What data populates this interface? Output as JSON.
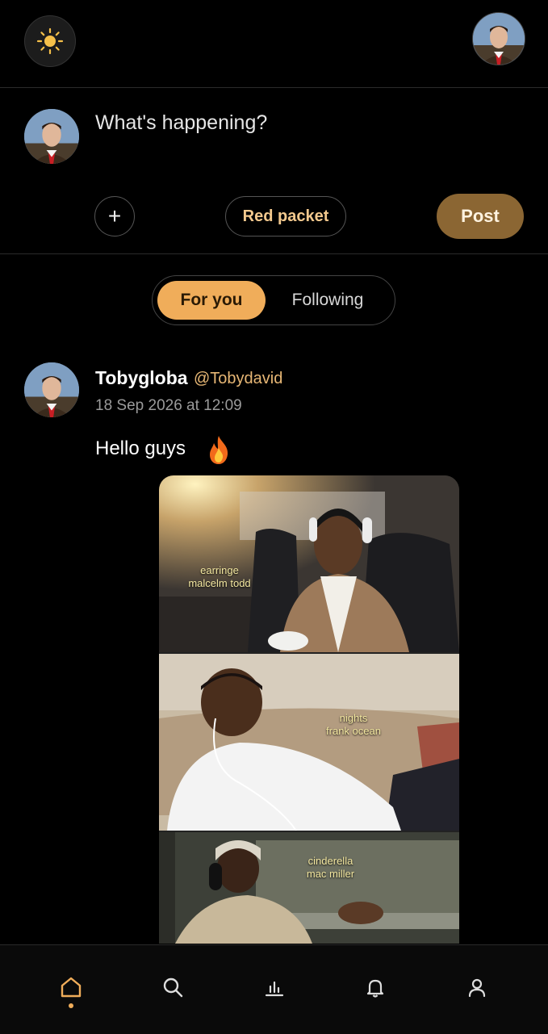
{
  "composer": {
    "placeholder": "What's happening?",
    "red_packet_label": "Red packet",
    "post_label": "Post",
    "plus_label": "+"
  },
  "feed_tabs": [
    {
      "label": "For you",
      "active": true
    },
    {
      "label": "Following",
      "active": false
    }
  ],
  "post": {
    "author": "Tobygloba",
    "handle": "@Tobydavid",
    "timestamp": "18 Sep 2026 at 12:09",
    "text": "Hello guys",
    "media_captions": [
      {
        "line1": "earringe",
        "line2": "malcelm todd"
      },
      {
        "line1": "nights",
        "line2": "frank ocean"
      },
      {
        "line1": "cinderella",
        "line2": "mac miller"
      }
    ]
  },
  "nav": {
    "items": [
      "home-icon",
      "search-icon",
      "stats-icon",
      "bell-icon",
      "profile-icon"
    ],
    "active": "home-icon"
  },
  "colors": {
    "accent": "#f0ad5a",
    "post_button": "#8b6633",
    "handle": "#e7b775",
    "background": "#000000"
  }
}
